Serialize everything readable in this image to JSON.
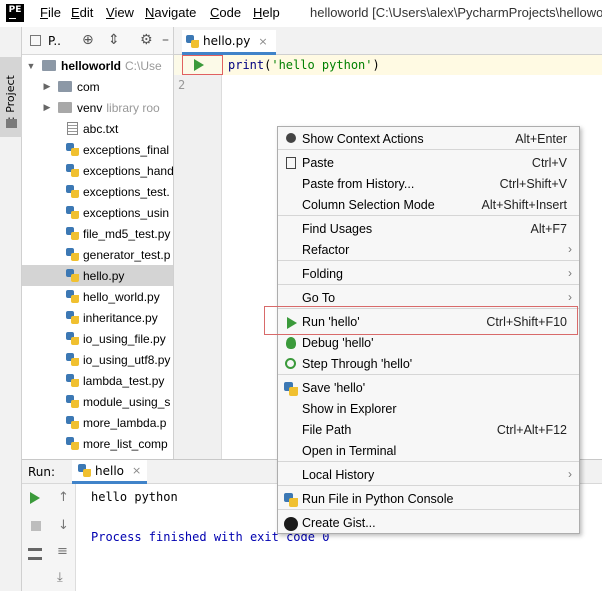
{
  "app": {
    "logo_text": "PE",
    "window_title": "helloworld [C:\\Users\\alex\\PycharmProjects\\helloworld]"
  },
  "menubar": {
    "items": [
      {
        "u": "F",
        "rest": "ile"
      },
      {
        "u": "E",
        "rest": "dit"
      },
      {
        "u": "V",
        "rest": "iew"
      },
      {
        "u": "N",
        "rest": "avigate"
      },
      {
        "u": "C",
        "rest": "ode"
      },
      {
        "u": "H",
        "rest": "elp"
      }
    ]
  },
  "left_stripe": {
    "project_label": "1: Project"
  },
  "project_panel": {
    "title": "P..",
    "toolbar_icons": [
      "target-icon",
      "collapse-icon",
      "gear-icon",
      "minimize-icon"
    ],
    "root": {
      "name": "helloworld",
      "path": "C:\\Use"
    },
    "folders": [
      {
        "name": "com",
        "note": ""
      },
      {
        "name": "venv",
        "note": "library roo"
      }
    ],
    "files": [
      {
        "name": "abc.txt",
        "type": "txt"
      },
      {
        "name": "exceptions_final",
        "type": "py"
      },
      {
        "name": "exceptions_hand",
        "type": "py"
      },
      {
        "name": "exceptions_test.",
        "type": "py"
      },
      {
        "name": "exceptions_usin",
        "type": "py"
      },
      {
        "name": "file_md5_test.py",
        "type": "py"
      },
      {
        "name": "generator_test.p",
        "type": "py"
      },
      {
        "name": "hello.py",
        "type": "py",
        "selected": true
      },
      {
        "name": "hello_world.py",
        "type": "py"
      },
      {
        "name": "inheritance.py",
        "type": "py"
      },
      {
        "name": "io_using_file.py",
        "type": "py"
      },
      {
        "name": "io_using_utf8.py",
        "type": "py"
      },
      {
        "name": "lambda_test.py",
        "type": "py"
      },
      {
        "name": "module_using_s",
        "type": "py"
      },
      {
        "name": "more_lambda.p",
        "type": "py"
      },
      {
        "name": "more_list_comp",
        "type": "py"
      }
    ]
  },
  "editor": {
    "tab": {
      "label": "hello.py",
      "close": "×"
    },
    "line_numbers": [
      "1",
      "2"
    ],
    "code": {
      "fn": "print",
      "open": "(",
      "str": "'hello python'",
      "close": ")"
    }
  },
  "run_panel": {
    "label": "Run:",
    "tab": {
      "label": "hello",
      "close": "×"
    },
    "console": {
      "output": "hello python",
      "exit": "Process finished with exit code 0"
    }
  },
  "context_menu": {
    "items": [
      {
        "label": "Show Context Actions",
        "shortcut": "Alt+Enter",
        "icon": "lightbulb-icon"
      },
      {
        "label": "Paste",
        "shortcut": "Ctrl+V",
        "icon": "clipboard-icon"
      },
      {
        "label": "Paste from History...",
        "shortcut": "Ctrl+Shift+V",
        "icon": ""
      },
      {
        "label": "Column Selection Mode",
        "shortcut": "Alt+Shift+Insert",
        "icon": ""
      },
      {
        "label": "Find Usages",
        "shortcut": "Alt+F7",
        "icon": ""
      },
      {
        "label": "Refactor",
        "shortcut": "",
        "icon": "",
        "submenu": true
      },
      {
        "label": "Folding",
        "shortcut": "",
        "icon": "",
        "submenu": true
      },
      {
        "label": "Go To",
        "shortcut": "",
        "icon": "",
        "submenu": true
      },
      {
        "label": "Run 'hello'",
        "shortcut": "Ctrl+Shift+F10",
        "icon": "run-icon"
      },
      {
        "label": "Debug 'hello'",
        "shortcut": "",
        "icon": "debug-icon"
      },
      {
        "label": "Step Through 'hello'",
        "shortcut": "",
        "icon": "step-through-icon"
      },
      {
        "label": "Save 'hello'",
        "shortcut": "",
        "icon": "python-icon"
      },
      {
        "label": "Show in Explorer",
        "shortcut": "",
        "icon": ""
      },
      {
        "label": "File Path",
        "shortcut": "Ctrl+Alt+F12",
        "icon": ""
      },
      {
        "label": "Open in Terminal",
        "shortcut": "",
        "icon": ""
      },
      {
        "label": "Local History",
        "shortcut": "",
        "icon": "",
        "submenu": true
      },
      {
        "label": "Run File in Python Console",
        "shortcut": "",
        "icon": "python-icon"
      },
      {
        "label": "Create Gist...",
        "shortcut": "",
        "icon": "github-icon"
      }
    ],
    "submenu_arrow": "›"
  },
  "colors": {
    "accent": "#4083c9",
    "run_green": "#3b9a3b",
    "highlight_red": "#d86a6a"
  }
}
